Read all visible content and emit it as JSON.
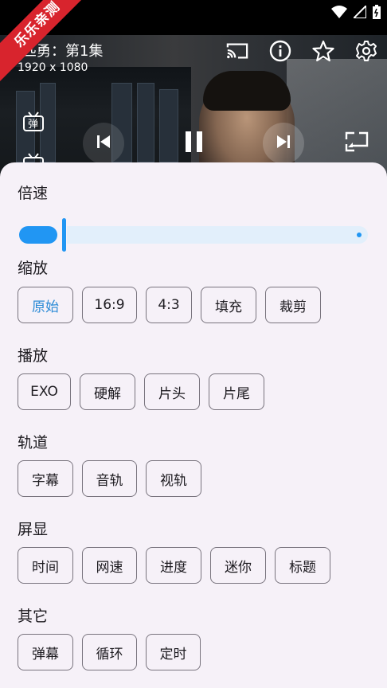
{
  "player": {
    "title": "匹勇：第1集",
    "resolution": "1920 x 1080"
  },
  "watermark": "乐乐亲测",
  "icons": {
    "cast": "cast-icon",
    "info": "info-icon",
    "favorite": "star-icon",
    "settings": "gear-icon",
    "danmu": "danmu-icon",
    "prev": "skip-previous-icon",
    "pause": "pause-icon",
    "next": "skip-next-icon",
    "rotate": "screen-rotation-icon"
  },
  "danmu_glyph": "弹",
  "sheet": {
    "speed": {
      "label": "倍速",
      "value": 0.12
    },
    "zoom": {
      "label": "缩放",
      "options": [
        "原始",
        "16:9",
        "4:3",
        "填充",
        "裁剪"
      ],
      "selected": "原始"
    },
    "playback": {
      "label": "播放",
      "options": [
        "EXO",
        "硬解",
        "片头",
        "片尾"
      ]
    },
    "tracks": {
      "label": "轨道",
      "options": [
        "字幕",
        "音轨",
        "视轨"
      ]
    },
    "display": {
      "label": "屏显",
      "options": [
        "时间",
        "网速",
        "进度",
        "迷你",
        "标题"
      ]
    },
    "other": {
      "label": "其它",
      "options": [
        "弹幕",
        "循环",
        "定时"
      ]
    }
  },
  "colors": {
    "accent": "#2196f3",
    "sheet_bg": "#f6f1f8",
    "watermark_bg": "#d8242d"
  }
}
